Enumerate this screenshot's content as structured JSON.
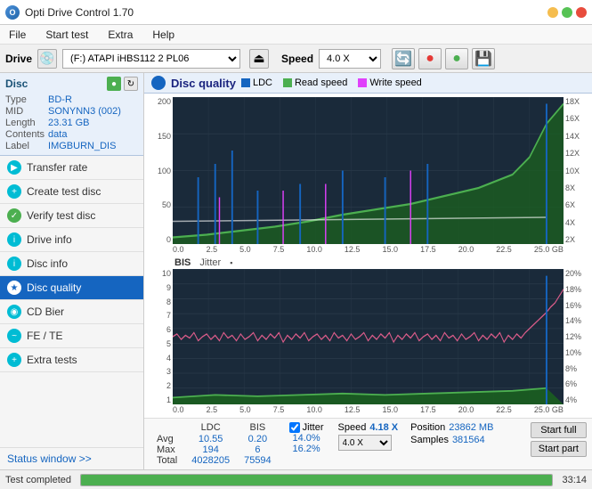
{
  "app": {
    "title": "Opti Drive Control 1.70",
    "icon": "O"
  },
  "menu": {
    "items": [
      "File",
      "Start test",
      "Extra",
      "Help"
    ]
  },
  "drive_bar": {
    "label": "Drive",
    "drive_value": "(F:) ATAPI iHBS112  2 PL06",
    "speed_label": "Speed",
    "speed_value": "4.0 X"
  },
  "disc_info": {
    "title": "Disc",
    "rows": [
      {
        "key": "Type",
        "value": "BD-R"
      },
      {
        "key": "MID",
        "value": "SONYNN3 (002)"
      },
      {
        "key": "Length",
        "value": "23.31 GB"
      },
      {
        "key": "Contents",
        "value": "data"
      },
      {
        "key": "Label",
        "value": "IMGBURN_DIS"
      }
    ]
  },
  "nav": {
    "items": [
      {
        "label": "Transfer rate",
        "active": false
      },
      {
        "label": "Create test disc",
        "active": false
      },
      {
        "label": "Verify test disc",
        "active": false
      },
      {
        "label": "Drive info",
        "active": false
      },
      {
        "label": "Disc info",
        "active": false
      },
      {
        "label": "Disc quality",
        "active": true
      },
      {
        "label": "CD Bier",
        "active": false
      },
      {
        "label": "FE / TE",
        "active": false
      },
      {
        "label": "Extra tests",
        "active": false
      }
    ]
  },
  "status_window": {
    "label": "Status window >>"
  },
  "chart": {
    "title": "Disc quality",
    "legend": {
      "ldc_label": "LDC",
      "read_label": "Read speed",
      "write_label": "Write speed",
      "ldc_color": "#1565c0",
      "read_color": "#4caf50",
      "write_color": "#e040fb"
    },
    "upper": {
      "y_left": [
        "200",
        "150",
        "100",
        "50",
        "0"
      ],
      "y_right": [
        "18X",
        "16X",
        "14X",
        "12X",
        "10X",
        "8X",
        "6X",
        "4X",
        "2X"
      ],
      "x_labels": [
        "0.0",
        "2.5",
        "5.0",
        "7.5",
        "10.0",
        "12.5",
        "15.0",
        "17.5",
        "20.0",
        "22.5",
        "25.0 GB"
      ]
    },
    "lower": {
      "title_label": "BIS",
      "jitter_label": "Jitter",
      "y_left": [
        "10",
        "9",
        "8",
        "7",
        "6",
        "5",
        "4",
        "3",
        "2",
        "1"
      ],
      "y_right": [
        "20%",
        "18%",
        "16%",
        "14%",
        "12%",
        "10%",
        "8%",
        "6%",
        "4%"
      ],
      "x_labels": [
        "0.0",
        "2.5",
        "5.0",
        "7.5",
        "10.0",
        "12.5",
        "15.0",
        "17.5",
        "20.0",
        "22.5",
        "25.0 GB"
      ]
    }
  },
  "stats": {
    "headers": [
      "LDC",
      "BIS"
    ],
    "rows": [
      {
        "label": "Avg",
        "ldc": "10.55",
        "bis": "0.20"
      },
      {
        "label": "Max",
        "ldc": "194",
        "bis": "6"
      },
      {
        "label": "Total",
        "ldc": "4028205",
        "bis": "75594"
      }
    ],
    "jitter": {
      "checked": true,
      "label": "Jitter",
      "avg": "14.0%",
      "max": "16.2%"
    },
    "speed": {
      "label": "Speed",
      "value": "4.18 X",
      "select": "4.0 X"
    },
    "position": {
      "label": "Position",
      "value": "23862 MB"
    },
    "samples": {
      "label": "Samples",
      "value": "381564"
    },
    "buttons": {
      "start_full": "Start full",
      "start_part": "Start part"
    }
  },
  "status_bar": {
    "text": "Test completed",
    "progress": 100,
    "time": "33:14"
  }
}
